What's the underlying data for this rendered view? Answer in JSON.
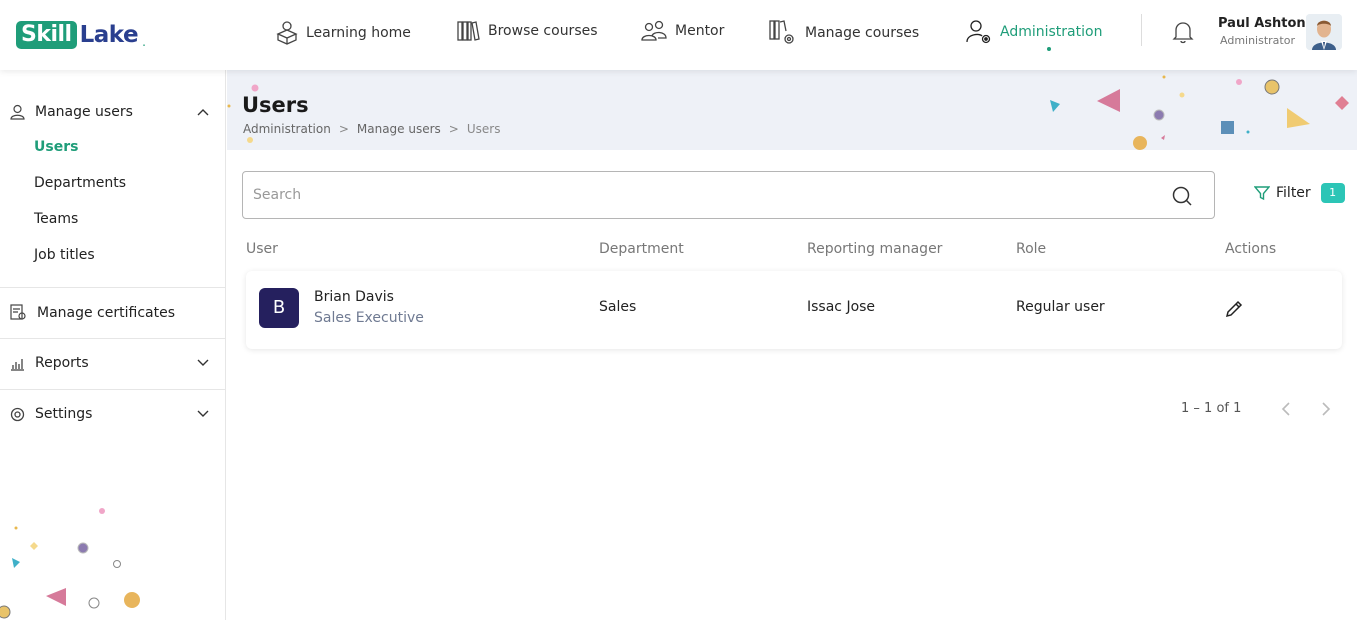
{
  "brand": {
    "skill": "Skill",
    "lake": "Lake"
  },
  "nav": {
    "items": [
      {
        "label": "Learning home",
        "icon": "learning-home-icon"
      },
      {
        "label": "Browse courses",
        "icon": "books-icon"
      },
      {
        "label": "Mentor",
        "icon": "mentor-icon"
      },
      {
        "label": "Manage courses",
        "icon": "manage-courses-icon"
      },
      {
        "label": "Administration",
        "icon": "admin-user-icon",
        "active": true
      }
    ]
  },
  "user": {
    "name": "Paul Ashton",
    "role": "Administrator"
  },
  "sidebar": {
    "manage_users": {
      "label": "Manage users",
      "expanded": true,
      "items": [
        {
          "label": "Users",
          "active": true
        },
        {
          "label": "Departments"
        },
        {
          "label": "Teams"
        },
        {
          "label": "Job titles"
        }
      ]
    },
    "manage_certificates": {
      "label": "Manage certificates"
    },
    "reports": {
      "label": "Reports"
    },
    "settings": {
      "label": "Settings"
    }
  },
  "page": {
    "title": "Users",
    "breadcrumb": [
      "Administration",
      "Manage users",
      "Users"
    ],
    "breadcrumb_sep": ">"
  },
  "search": {
    "placeholder": "Search",
    "value": ""
  },
  "filter": {
    "label": "Filter",
    "count": "1"
  },
  "table": {
    "columns": [
      "User",
      "Department",
      "Reporting manager",
      "Role",
      "Actions"
    ],
    "rows": [
      {
        "initial": "B",
        "name": "Brian Davis",
        "title": "Sales Executive",
        "department": "Sales",
        "manager": "Issac Jose",
        "role": "Regular user"
      }
    ]
  },
  "pagination": {
    "text": "1 – 1 of 1"
  },
  "colors": {
    "accent": "#1f9d79",
    "brand_blue": "#2a3f8f",
    "badge": "#2cc5b6",
    "avatar_bg": "#25205e"
  }
}
